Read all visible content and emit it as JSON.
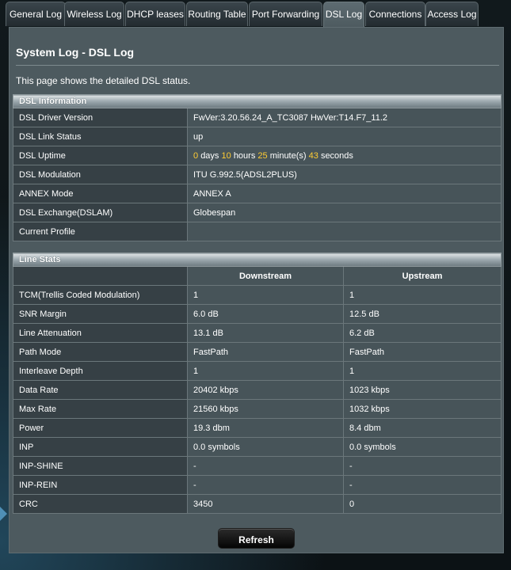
{
  "tabs": [
    {
      "label": "General Log",
      "active": false
    },
    {
      "label": "Wireless Log",
      "active": false
    },
    {
      "label": "DHCP leases",
      "active": false
    },
    {
      "label": "Routing Table",
      "active": false
    },
    {
      "label": "Port Forwarding",
      "active": false
    },
    {
      "label": "DSL Log",
      "active": true
    },
    {
      "label": "Connections",
      "active": false
    },
    {
      "label": "Access Log",
      "active": false
    }
  ],
  "page": {
    "title": "System Log - DSL Log",
    "description": "This page shows the detailed DSL status."
  },
  "dsl_info": {
    "section_title": "DSL Information",
    "rows": [
      {
        "label": "DSL Driver Version",
        "value": "FwVer:3.20.56.24_A_TC3087 HwVer:T14.F7_11.2"
      },
      {
        "label": "DSL Link Status",
        "value": "up"
      },
      {
        "label": "DSL Uptime"
      },
      {
        "label": "DSL Modulation",
        "value": "ITU G.992.5(ADSL2PLUS)"
      },
      {
        "label": "ANNEX Mode",
        "value": "ANNEX A"
      },
      {
        "label": "DSL Exchange(DSLAM)",
        "value": "Globespan"
      },
      {
        "label": "Current Profile",
        "value": ""
      }
    ],
    "uptime": {
      "days": "0",
      "days_unit": "days",
      "hours": "10",
      "hours_unit": "hours",
      "minutes": "25",
      "minutes_unit": "minute(s)",
      "seconds": "43",
      "seconds_unit": "seconds"
    }
  },
  "line_stats": {
    "section_title": "Line Stats",
    "col_downstream": "Downstream",
    "col_upstream": "Upstream",
    "rows": [
      {
        "label": "TCM(Trellis Coded Modulation)",
        "down": "1",
        "up": "1"
      },
      {
        "label": "SNR Margin",
        "down": "6.0 dB",
        "up": "12.5 dB"
      },
      {
        "label": "Line Attenuation",
        "down": "13.1 dB",
        "up": "6.2 dB"
      },
      {
        "label": "Path Mode",
        "down": "FastPath",
        "up": "FastPath"
      },
      {
        "label": "Interleave Depth",
        "down": "1",
        "up": "1"
      },
      {
        "label": "Data Rate",
        "down": "20402 kbps",
        "up": "1023 kbps"
      },
      {
        "label": "Max Rate",
        "down": "21560 kbps",
        "up": "1032 kbps"
      },
      {
        "label": "Power",
        "down": "19.3 dbm",
        "up": "8.4 dbm"
      },
      {
        "label": "INP",
        "down": "0.0 symbols",
        "up": "0.0 symbols"
      },
      {
        "label": "INP-SHINE",
        "down": "-",
        "up": "-"
      },
      {
        "label": "INP-REIN",
        "down": "-",
        "up": "-"
      },
      {
        "label": "CRC",
        "down": "3450",
        "up": "0"
      }
    ]
  },
  "buttons": {
    "refresh": "Refresh"
  },
  "colors": {
    "highlight": "#ffcc33",
    "panel": "#4d5a5f",
    "label_cell": "#364045",
    "value_cell": "#475459"
  }
}
